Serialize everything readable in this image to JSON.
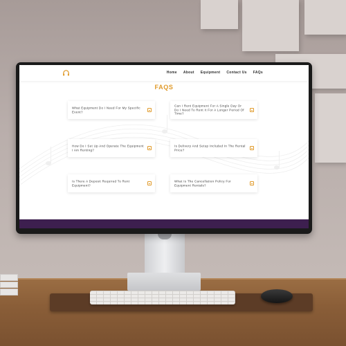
{
  "site": {
    "nav": [
      "Home",
      "About",
      "Equipment",
      "Contact Us",
      "FAQs"
    ],
    "page_title": "FAQS",
    "faqs": [
      {
        "question": "What Equipment Do I Need For My Specific Event?"
      },
      {
        "question": "Can I Rent Equipment For A Single Day Or Do I Need To Rent It For A Longer Period Of Time?"
      },
      {
        "question": "How Do I Set Up And Operate The Equipment I Am Renting?"
      },
      {
        "question": "Is Delivery And Setup Included In The Rental Price?"
      },
      {
        "question": "Is There A Deposit Required To Rent Equipment?"
      },
      {
        "question": "What Is The Cancellation Policy For Equipment Rentals?"
      }
    ],
    "icons": {
      "logo": "headphones-icon",
      "toggle": "collapse-toggle-icon"
    },
    "colors": {
      "accent": "#e09a2a",
      "footer": "#3d1f4f"
    }
  }
}
